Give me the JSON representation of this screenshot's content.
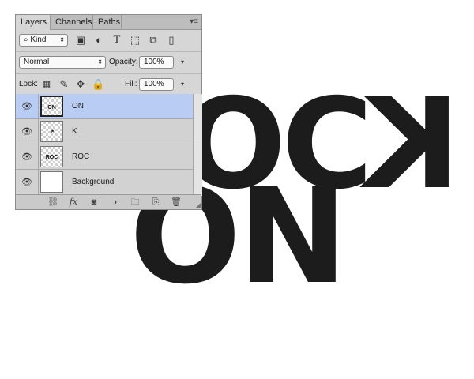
{
  "canvas": {
    "row1": "OC",
    "row1_flipped": "K",
    "row2": "ON"
  },
  "panel": {
    "tabs": [
      "Layers",
      "Channels",
      "Paths"
    ],
    "menu_icon": "panel-menu-icon",
    "filter": {
      "value": "Kind"
    },
    "blend": {
      "value": "Normal",
      "opacity_label": "Opacity:",
      "opacity_value": "100%"
    },
    "lock": {
      "label": "Lock:",
      "fill_label": "Fill:",
      "fill_value": "100%"
    },
    "layers": [
      {
        "name": "ON",
        "thumb": "ON",
        "selected": true
      },
      {
        "name": "K",
        "thumb": "↗",
        "selected": false
      },
      {
        "name": "ROC",
        "thumb": "ROC",
        "selected": false
      },
      {
        "name": "Background",
        "thumb": "",
        "selected": false
      }
    ],
    "bottom_fx": "fx"
  }
}
